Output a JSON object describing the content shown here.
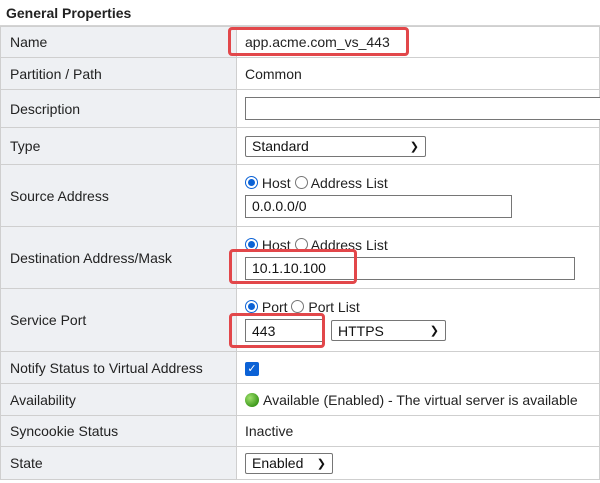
{
  "section_title": "General Properties",
  "rows": {
    "name": {
      "label": "Name",
      "value": "app.acme.com_vs_443"
    },
    "partition": {
      "label": "Partition / Path",
      "value": "Common"
    },
    "description": {
      "label": "Description",
      "value": ""
    },
    "type": {
      "label": "Type",
      "selected": "Standard"
    },
    "source": {
      "label": "Source Address",
      "radio_host": "Host",
      "radio_list": "Address List",
      "selected_radio": "Host",
      "value": "0.0.0.0/0"
    },
    "destination": {
      "label": "Destination Address/Mask",
      "radio_host": "Host",
      "radio_list": "Address List",
      "selected_radio": "Host",
      "value": "10.1.10.100"
    },
    "service_port": {
      "label": "Service Port",
      "radio_port": "Port",
      "radio_list": "Port List",
      "selected_radio": "Port",
      "value": "443",
      "protocol": "HTTPS"
    },
    "notify": {
      "label": "Notify Status to Virtual Address",
      "checked": true
    },
    "availability": {
      "label": "Availability",
      "status": "Available (Enabled) - The virtual server is available",
      "status_color": "#3f9a1e"
    },
    "syncookie": {
      "label": "Syncookie Status",
      "value": "Inactive"
    },
    "state": {
      "label": "State",
      "selected": "Enabled"
    }
  },
  "colors": {
    "highlight": "#e2474a",
    "accent": "#0b62d6",
    "label_bg": "#eef0f3"
  }
}
